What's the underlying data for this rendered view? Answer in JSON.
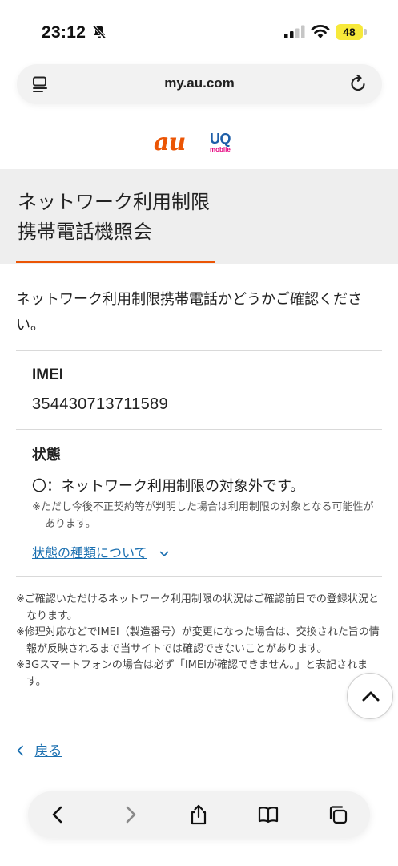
{
  "status_bar": {
    "time": "23:12",
    "battery": "48"
  },
  "browser": {
    "url": "my.au.com"
  },
  "brand": {
    "au": "au",
    "uq": "UQ",
    "uq_sub": "mobile",
    "accent": "#eb5505"
  },
  "page": {
    "title_line1": "ネットワーク利用制限",
    "title_line2": "携帯電話機照会",
    "intro": "ネットワーク利用制限携帯電話かどうかご確認ください。",
    "imei_label": "IMEI",
    "imei_value": "354430713711589",
    "state_label": "状態",
    "state_result": "〇：ネットワーク利用制限の対象外です。",
    "state_note": "※ただし今後不正契約等が判明した場合は利用制限の対象となる可能性があります。",
    "state_link": "状態の種類について",
    "footnotes": [
      "※ご確認いただけるネットワーク利用制限の状況はご確認前日での登録状況となります。",
      "※修理対応などでIMEI（製造番号）が変更になった場合は、交換された旨の情報が反映されるまで当サイトでは確認できないことがあります。",
      "※3Gスマートフォンの場合は必ず「IMEIが確認できません。」と表記されます。"
    ],
    "back_link": "戻る"
  }
}
